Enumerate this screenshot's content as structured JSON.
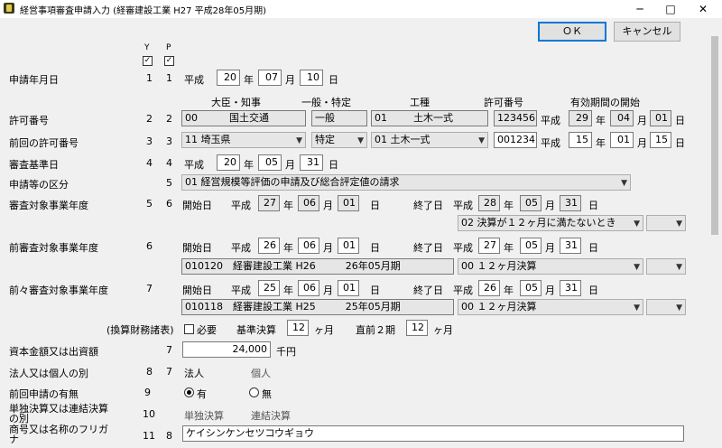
{
  "window": {
    "title": "経営事項審査申請入力 (経審建設工業 H27 平成28年05月期)",
    "minimize": "─",
    "maximize": "□",
    "close": "✕"
  },
  "buttons": {
    "ok": "ＯＫ",
    "cancel": "キャンセル"
  },
  "headers": {
    "y": "Y",
    "p": "P",
    "check_y": "✓",
    "check_p": "✓"
  },
  "common": {
    "heisei": "平成",
    "nen": "年",
    "gatsu": "月",
    "nichi": "日",
    "kaishi": "開始日",
    "shuryo": "終了日"
  },
  "application_date": {
    "label": "申請年月日",
    "y": "1",
    "p": "1",
    "year": "20",
    "month": "07",
    "day": "10"
  },
  "permit_headers": {
    "minister": "大臣・知事",
    "general": "一般・特定",
    "kind": "工種",
    "number": "許可番号",
    "valid": "有効期間の開始"
  },
  "permit": {
    "label": "許可番号",
    "y": "2",
    "p": "2",
    "minister_code": "00",
    "minister_name": "国土交通",
    "general": "一般",
    "kind_code": "01",
    "kind_name": "土木一式",
    "number": "123456",
    "year": "29",
    "month": "04",
    "day": "01"
  },
  "prev_permit": {
    "label": "前回の許可番号",
    "y": "3",
    "p": "3",
    "minister": "11 埼玉県",
    "general": "特定",
    "kind": "01 土木一式",
    "number": "001234",
    "year": "15",
    "month": "01",
    "day": "15"
  },
  "review_date": {
    "label": "審査基準日",
    "y": "4",
    "p": "4",
    "year": "20",
    "month": "05",
    "day": "31"
  },
  "application_type": {
    "label": "申請等の区分",
    "p": "5",
    "value": "01 経営規模等評価の申請及び総合評定値の請求"
  },
  "target_year": {
    "label": "審査対象事業年度",
    "y": "5",
    "p": "6",
    "start_year": "27",
    "start_month": "06",
    "start_day": "01",
    "end_year": "28",
    "end_month": "05",
    "end_day": "31",
    "settlement": "02 決算が１２ヶ月に満たないとき",
    "extra": ""
  },
  "prev_year": {
    "label": "前審査対象事業年度",
    "y": "6",
    "start_year": "26",
    "start_month": "06",
    "start_day": "01",
    "end_year": "27",
    "end_month": "05",
    "end_day": "31",
    "company": "010120　経審建設工業 H26　　　26年05月期",
    "settlement": "00 １２ヶ月決算",
    "extra": ""
  },
  "prev2_year": {
    "label": "前々審査対象事業年度",
    "y": "7",
    "start_year": "25",
    "start_month": "06",
    "start_day": "01",
    "end_year": "26",
    "end_month": "05",
    "end_day": "31",
    "company": "010118　経審建設工業 H25　　　25年05月期",
    "settlement": "00 １２ヶ月決算",
    "extra": ""
  },
  "conversion": {
    "label": "(換算財務諸表)",
    "required": "必要",
    "base_label": "基準決算",
    "base_value": "12",
    "recent_label": "直前２期",
    "recent_value": "12",
    "unit": "ヶ月"
  },
  "capital": {
    "label": "資本金額又は出資額",
    "p": "7",
    "value": "24,000",
    "unit": "千円"
  },
  "entity": {
    "label": "法人又は個人の別",
    "y": "8",
    "p": "7",
    "corp": "法人",
    "individual": "個人"
  },
  "prev_application": {
    "label": "前回申請の有無",
    "y": "9",
    "yes": "有",
    "no": "無"
  },
  "consolidated": {
    "label": "単独決算又は連結決算の別",
    "y": "10",
    "single": "単独決算",
    "consolidated": "連結決算"
  },
  "furigana": {
    "label": "商号又は名称のフリガナ",
    "y": "11",
    "p": "8",
    "value": "ケイシンケンセツコウギョウ"
  }
}
